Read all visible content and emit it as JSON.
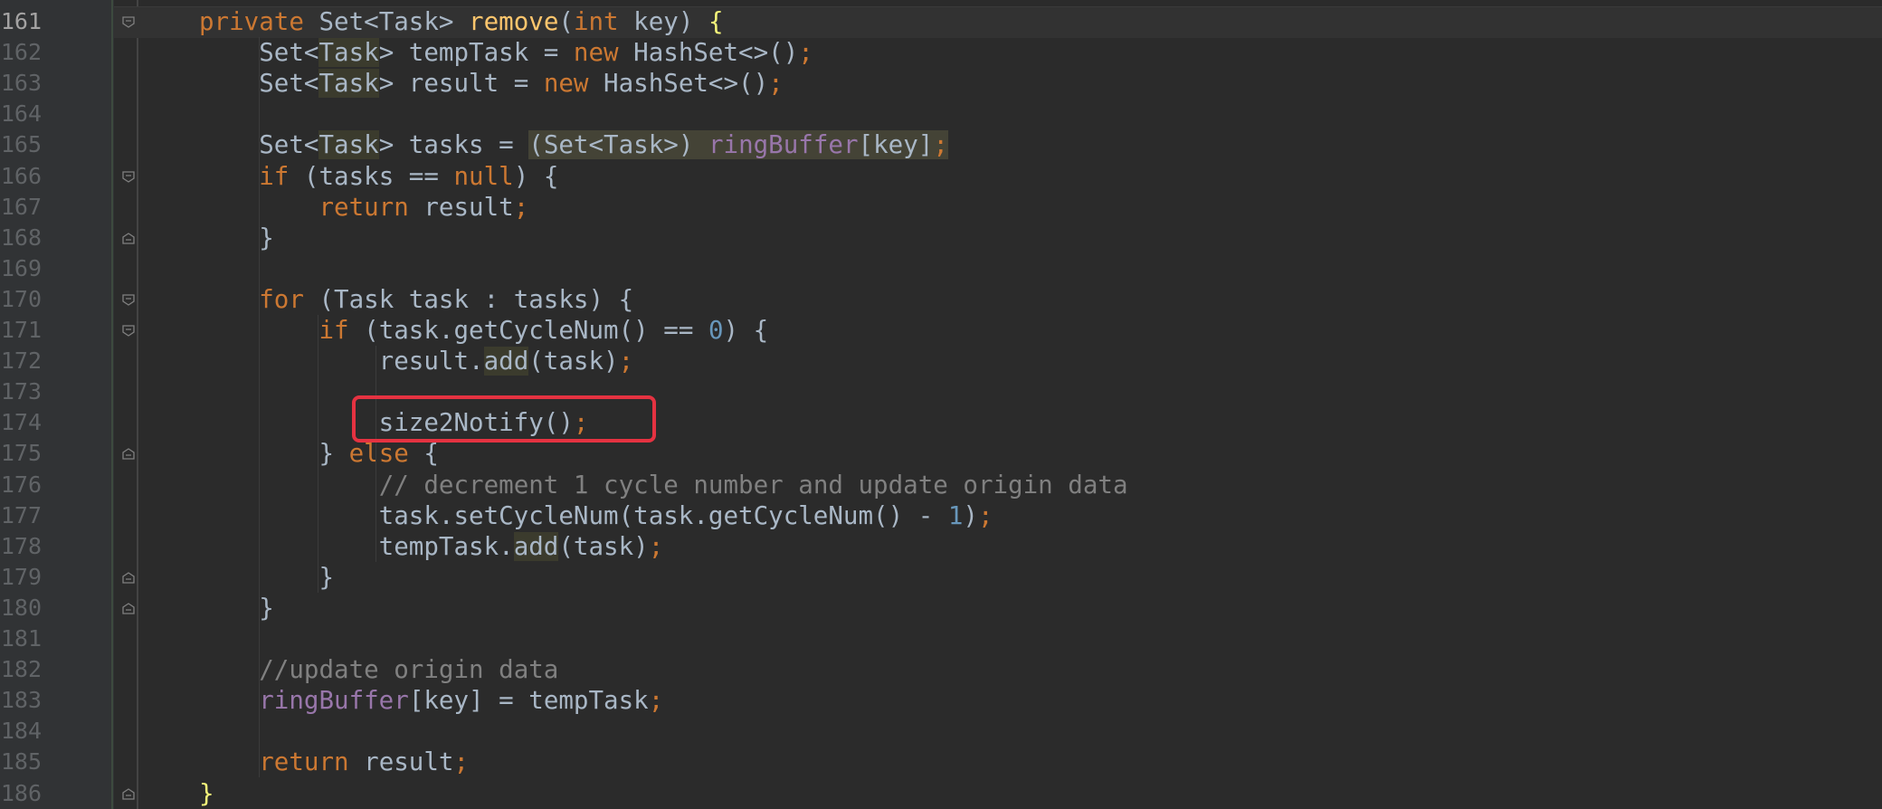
{
  "editor": {
    "lines": [
      {
        "n": "161",
        "tokens": [
          [
            "kw",
            "private"
          ],
          [
            "t",
            " Set<Task> "
          ],
          [
            "fn",
            "remove"
          ],
          [
            "t",
            "("
          ],
          [
            "kw",
            "int"
          ],
          [
            "t",
            " key) "
          ],
          [
            "brace",
            "{"
          ]
        ]
      },
      {
        "n": "162",
        "tokens": [
          [
            "t",
            "    Set<"
          ],
          [
            "hl",
            "Task"
          ],
          [
            "t",
            "> tempTask = "
          ],
          [
            "kw",
            "new"
          ],
          [
            "t",
            " HashSet<>()"
          ],
          [
            "kw",
            ";"
          ]
        ]
      },
      {
        "n": "163",
        "tokens": [
          [
            "t",
            "    Set<"
          ],
          [
            "hl",
            "Task"
          ],
          [
            "t",
            "> result = "
          ],
          [
            "kw",
            "new"
          ],
          [
            "t",
            " HashSet<>()"
          ],
          [
            "kw",
            ";"
          ]
        ]
      },
      {
        "n": "164",
        "tokens": []
      },
      {
        "n": "165",
        "tokens": [
          [
            "t",
            "    Set<"
          ],
          [
            "hl",
            "Task"
          ],
          [
            "t",
            "> tasks = "
          ],
          [
            "hl2",
            "(Set<Task>) "
          ],
          [
            "fldhl",
            "ringBuffer"
          ],
          [
            "hl2",
            "[key]"
          ],
          [
            "kwhl",
            ";"
          ]
        ]
      },
      {
        "n": "166",
        "tokens": [
          [
            "t",
            "    "
          ],
          [
            "kw",
            "if"
          ],
          [
            "t",
            " (tasks == "
          ],
          [
            "kw",
            "null"
          ],
          [
            "t",
            ") {"
          ]
        ]
      },
      {
        "n": "167",
        "tokens": [
          [
            "t",
            "        "
          ],
          [
            "kw",
            "return"
          ],
          [
            "t",
            " result"
          ],
          [
            "kw",
            ";"
          ]
        ]
      },
      {
        "n": "168",
        "tokens": [
          [
            "t",
            "    }"
          ]
        ]
      },
      {
        "n": "169",
        "tokens": []
      },
      {
        "n": "170",
        "tokens": [
          [
            "t",
            "    "
          ],
          [
            "kw",
            "for"
          ],
          [
            "t",
            " (Task task : tasks) {"
          ]
        ]
      },
      {
        "n": "171",
        "tokens": [
          [
            "t",
            "        "
          ],
          [
            "kw",
            "if"
          ],
          [
            "t",
            " (task.getCycleNum() == "
          ],
          [
            "num",
            "0"
          ],
          [
            "t",
            ") {"
          ]
        ]
      },
      {
        "n": "172",
        "tokens": [
          [
            "t",
            "            result."
          ],
          [
            "hl",
            "add"
          ],
          [
            "t",
            "(task)"
          ],
          [
            "kw",
            ";"
          ]
        ]
      },
      {
        "n": "173",
        "tokens": []
      },
      {
        "n": "174",
        "tokens": [
          [
            "t",
            "            size2Notify()"
          ],
          [
            "kw",
            ";"
          ]
        ]
      },
      {
        "n": "175",
        "tokens": [
          [
            "t",
            "        } "
          ],
          [
            "kw",
            "else"
          ],
          [
            "t",
            " {"
          ]
        ]
      },
      {
        "n": "176",
        "tokens": [
          [
            "t",
            "            "
          ],
          [
            "cmt",
            "// decrement 1 cycle number and update origin data"
          ]
        ]
      },
      {
        "n": "177",
        "tokens": [
          [
            "t",
            "            task.setCycleNum(task.getCycleNum() - "
          ],
          [
            "num",
            "1"
          ],
          [
            "t",
            ")"
          ],
          [
            "kw",
            ";"
          ]
        ]
      },
      {
        "n": "178",
        "tokens": [
          [
            "t",
            "            tempTask."
          ],
          [
            "hl",
            "add"
          ],
          [
            "t",
            "(task)"
          ],
          [
            "kw",
            ";"
          ]
        ]
      },
      {
        "n": "179",
        "tokens": [
          [
            "t",
            "        }"
          ]
        ]
      },
      {
        "n": "180",
        "tokens": [
          [
            "t",
            "    }"
          ]
        ]
      },
      {
        "n": "181",
        "tokens": []
      },
      {
        "n": "182",
        "tokens": [
          [
            "t",
            "    "
          ],
          [
            "cmt",
            "//update origin data"
          ]
        ]
      },
      {
        "n": "183",
        "tokens": [
          [
            "t",
            "    "
          ],
          [
            "fld",
            "ringBuffer"
          ],
          [
            "t",
            "[key] = tempTask"
          ],
          [
            "kw",
            ";"
          ]
        ]
      },
      {
        "n": "184",
        "tokens": []
      },
      {
        "n": "185",
        "tokens": [
          [
            "t",
            "    "
          ],
          [
            "kw",
            "return"
          ],
          [
            "t",
            " result"
          ],
          [
            "kw",
            ";"
          ]
        ]
      },
      {
        "n": "186",
        "tokens": [
          [
            "brace",
            "}"
          ]
        ]
      }
    ],
    "fold_markers": {
      "161": "open",
      "166": "open",
      "168": "close",
      "170": "open",
      "171": "open",
      "175": "close",
      "179": "close",
      "180": "close",
      "186": "close"
    },
    "highlighted_line": "174",
    "current_line": "161",
    "colors": {
      "background": "#2b2b2b",
      "keyword": "#cc7832",
      "method": "#ffc66d",
      "field": "#9876aa",
      "number": "#6897bb",
      "comment": "#808080",
      "highlight_box": "#e53241"
    }
  }
}
